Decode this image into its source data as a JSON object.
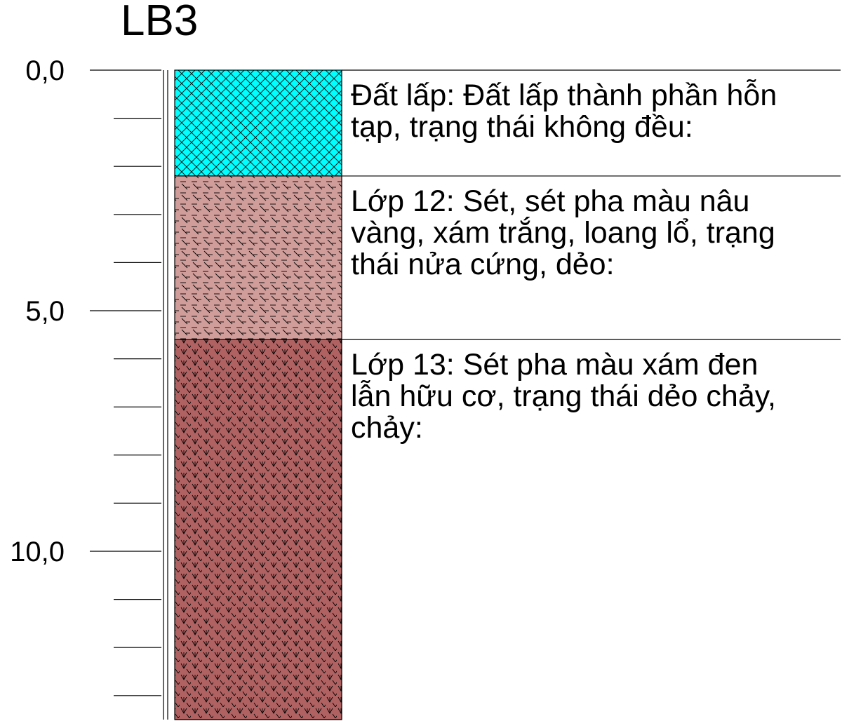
{
  "borehole": {
    "title": "LB3",
    "depth_axis": {
      "min": 0,
      "max": 12.5,
      "major_step": 5,
      "minor_step": 1,
      "labels": [
        "0,0",
        "5,0",
        "10,0"
      ]
    },
    "layers": [
      {
        "name": "Đất lấp",
        "top": 0.0,
        "bottom": 2.2,
        "color": "#00FFFF",
        "pattern": "crosshatch",
        "description_lines": [
          "Đất lấp: Đất lấp thành phần hỗn",
          "tạp, trạng thái không đều:"
        ]
      },
      {
        "name": "Lớp 12",
        "top": 2.2,
        "bottom": 5.6,
        "color": "#D09D9A",
        "pattern": "clay-dash",
        "description_lines": [
          "Lớp 12: Sét, sét pha màu nâu",
          "vàng, xám trắng, loang lổ, trạng",
          "thái nửa cứng, dẻo:"
        ]
      },
      {
        "name": "Lớp 13",
        "top": 5.6,
        "bottom": 13.5,
        "color": "#B06262",
        "pattern": "organic-v",
        "description_lines": [
          "Lớp 13: Sét pha màu xám đen",
          "lẫn hữu cơ, trạng thái dẻo chảy,",
          "chảy:"
        ]
      }
    ]
  }
}
